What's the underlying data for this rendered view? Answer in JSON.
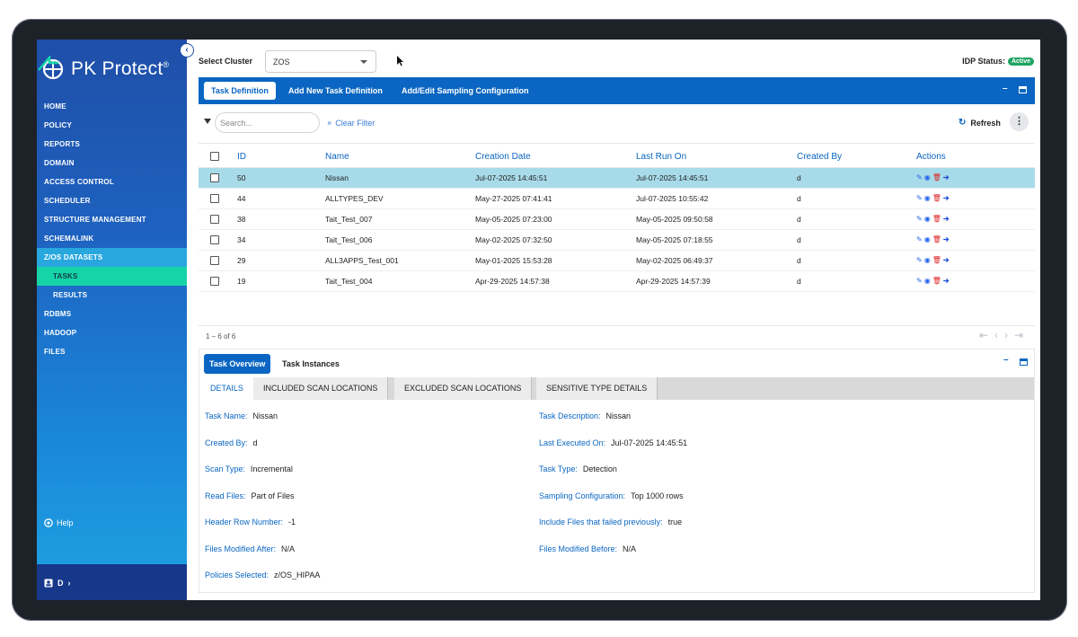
{
  "app": {
    "logo_text": "PK Protect",
    "logo_mark": "®"
  },
  "sidebar": {
    "items": [
      {
        "label": "HOME"
      },
      {
        "label": "POLICY"
      },
      {
        "label": "REPORTS"
      },
      {
        "label": "DOMAIN"
      },
      {
        "label": "ACCESS CONTROL"
      },
      {
        "label": "SCHEDULER"
      },
      {
        "label": "STRUCTURE MANAGEMENT"
      },
      {
        "label": "SCHEMALINK"
      },
      {
        "label": "Z/OS DATASETS"
      },
      {
        "label": "TASKS"
      },
      {
        "label": "RESULTS"
      },
      {
        "label": "RDBMS"
      },
      {
        "label": "HADOOP"
      },
      {
        "label": "FILES"
      }
    ],
    "help_label": "Help",
    "user_label": "D",
    "user_chevron": "›"
  },
  "topbar": {
    "cluster_label": "Select Cluster",
    "cluster_value": "ZOS",
    "idp_label": "IDP Status:",
    "idp_value": "Active"
  },
  "header_tabs": [
    "Task Definition",
    "Add New Task Definition",
    "Add/Edit Sampling Configuration"
  ],
  "filter": {
    "search_placeholder": "Search...",
    "clear_label": "Clear Filter",
    "clear_icon": "×",
    "refresh_label": "Refresh",
    "refresh_icon": "↻",
    "more_icon": "⋮"
  },
  "table": {
    "columns": [
      "ID",
      "Name",
      "Creation Date",
      "Last Run On",
      "Created By",
      "Actions"
    ],
    "rows": [
      {
        "id": "50",
        "name": "Nissan",
        "created": "Jul-07-2025 14:45:51",
        "last_run": "Jul-07-2025 14:45:51",
        "by": "d"
      },
      {
        "id": "44",
        "name": "ALLTYPES_DEV",
        "created": "May-27-2025 07:41:41",
        "last_run": "Jul-07-2025 10:55:42",
        "by": "d"
      },
      {
        "id": "38",
        "name": "Tait_Test_007",
        "created": "May-05-2025 07:23:00",
        "last_run": "May-05-2025 09:50:58",
        "by": "d"
      },
      {
        "id": "34",
        "name": "Tait_Test_006",
        "created": "May-02-2025 07:32:50",
        "last_run": "May-05-2025 07:18:55",
        "by": "d"
      },
      {
        "id": "29",
        "name": "ALL3APPS_Test_001",
        "created": "May-01-2025 15:53:28",
        "last_run": "May-02-2025 06:49:37",
        "by": "d"
      },
      {
        "id": "19",
        "name": "Tait_Test_004",
        "created": "Apr-29-2025 14:57:38",
        "last_run": "Apr-29-2025 14:57:39",
        "by": "d"
      }
    ],
    "action_icons": {
      "edit": "✎",
      "view": "◉",
      "delete": "🗑",
      "go": "➔"
    },
    "pager_text": "1 – 6 of 6",
    "pager_nav": "⇤‹›⇥"
  },
  "detail": {
    "tabs": [
      "Task Overview",
      "Task Instances"
    ],
    "subtabs": [
      "DETAILS",
      "INCLUDED SCAN LOCATIONS",
      "EXCLUDED SCAN LOCATIONS",
      "SENSITIVE TYPE DETAILS"
    ],
    "fields_left": [
      {
        "k": "Task Name:",
        "v": "Nissan"
      },
      {
        "k": "Created By:",
        "v": "d"
      },
      {
        "k": "Scan Type:",
        "v": "Incremental"
      },
      {
        "k": "Read Files:",
        "v": "Part of Files"
      },
      {
        "k": "Header Row Number:",
        "v": "-1"
      },
      {
        "k": "Files Modified After:",
        "v": "N/A"
      },
      {
        "k": "Policies Selected:",
        "v": "z/OS_HIPAA"
      }
    ],
    "fields_right": [
      {
        "k": "Task Description:",
        "v": "Nissan"
      },
      {
        "k": "Last Executed On:",
        "v": "Jul-07-2025 14:45:51"
      },
      {
        "k": "Task Type:",
        "v": "Detection"
      },
      {
        "k": "Sampling Configuration:",
        "v": "Top 1000 rows"
      },
      {
        "k": "Include Files that failed previously:",
        "v": "true"
      },
      {
        "k": "Files Modified Before:",
        "v": "N/A"
      }
    ]
  },
  "colors": {
    "brand": "#0a66c2",
    "active_nav": "#16d4a8",
    "selected_row": "#a8dbe9",
    "badge": "#1fa463"
  }
}
